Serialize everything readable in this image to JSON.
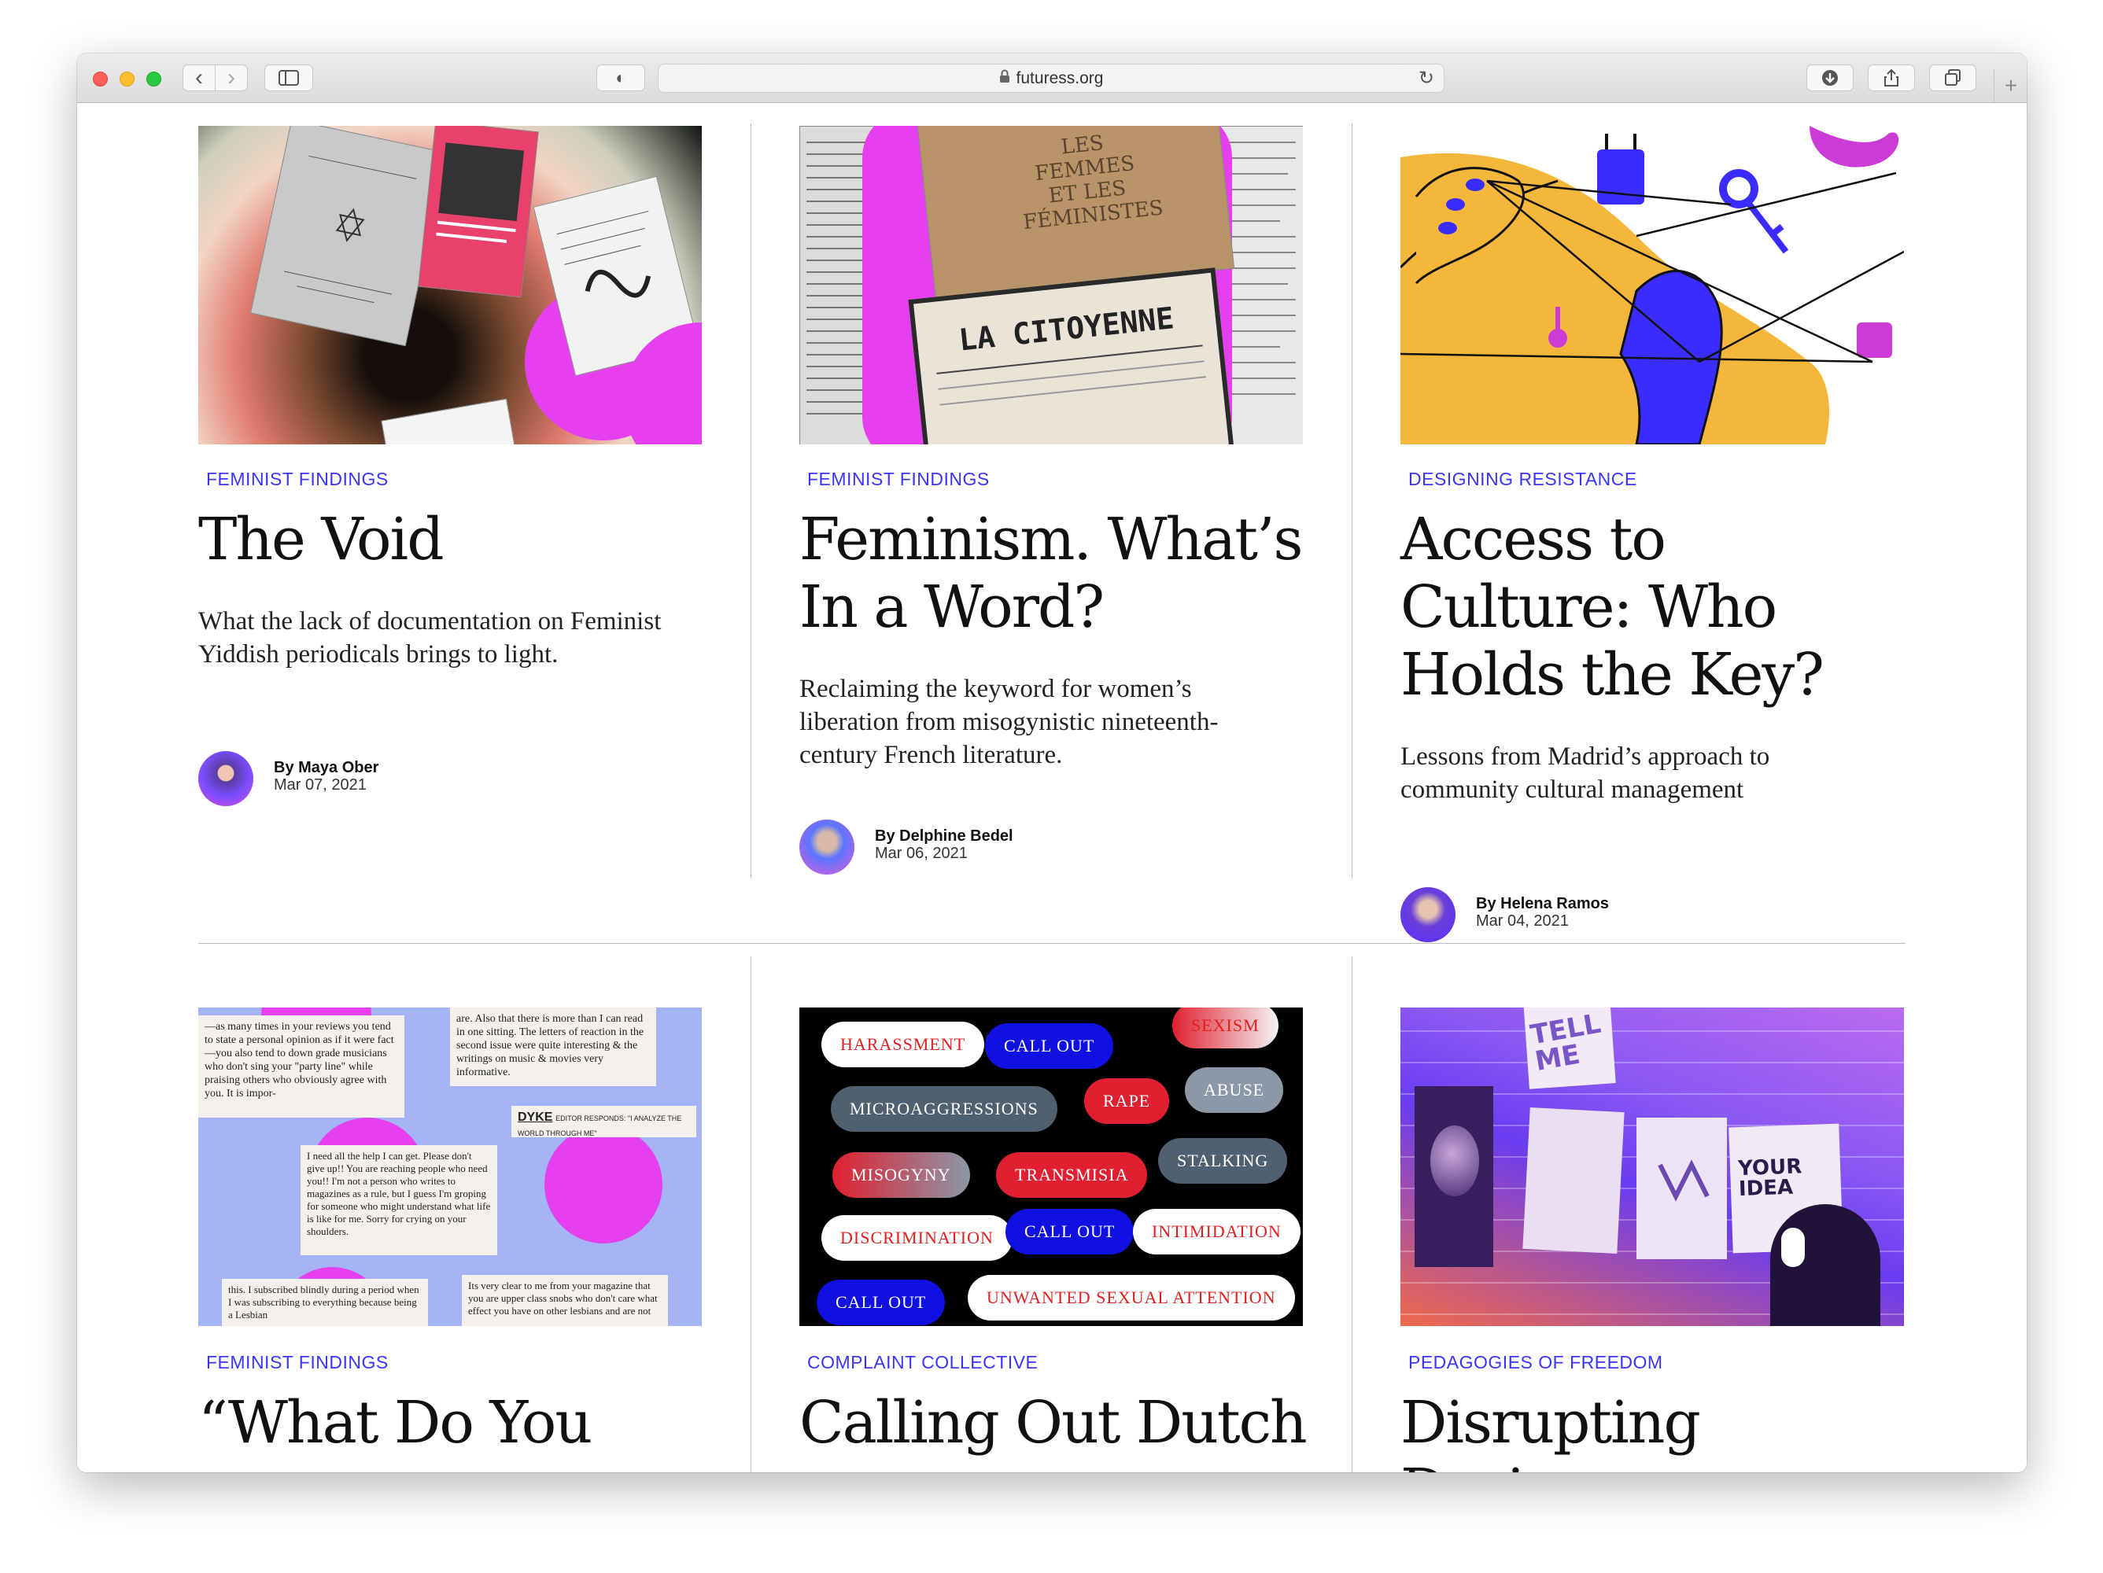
{
  "browser": {
    "url": "futuress.org",
    "icons": [
      "back-icon",
      "forward-icon",
      "sidebar-icon",
      "shield-icon",
      "lock-icon",
      "reload-icon",
      "download-icon",
      "share-icon",
      "tabs-icon",
      "new-tab-icon"
    ],
    "back_glyph": "‹",
    "forward_glyph": "›",
    "reload_glyph": "↻",
    "download_glyph": "⬇",
    "share_glyph": "⇧",
    "tabs_glyph": "⧉",
    "new_tab_glyph": "+",
    "lock_glyph": "🔒",
    "shield_glyph": "◐"
  },
  "articles": [
    {
      "category": "Feminist Findings",
      "title": "The Void",
      "description": "What the lack of documentation on Feminist Yiddish periodicals brings to light.",
      "author": "By Maya Ober",
      "date": "Mar 07, 2021"
    },
    {
      "category": "Feminist Findings",
      "title": "Feminism. What’s In a Word?",
      "description": "Reclaiming the keyword for women’s liberation from misogynistic nineteenth-century French literature.",
      "author": "By Delphine Bedel",
      "date": "Mar 06, 2021"
    },
    {
      "category": "Designing Resistance",
      "title": "Access to Culture: Who Holds the Key?",
      "description": "Lessons from Madrid’s approach to community cultural management",
      "author": "By Helena Ramos",
      "date": "Mar 04, 2021"
    },
    {
      "category": "Feminist Findings",
      "title": "“What Do You"
    },
    {
      "category": "Complaint Collective",
      "title": "Calling Out Dutch"
    },
    {
      "category": "Pedagogies of Freedom",
      "title": "Disrupting Design"
    }
  ],
  "image_text": {
    "citoyenne": "LA CITOYENNE",
    "femmes": "LES FEMMES ET LES FÉMINISTES",
    "dyke": "DYKE",
    "dyke_sub": "EDITOR RESPONDS: \"I ANALYZE THE WORLD THROUGH ME\"",
    "snippet1": "—as many times in your reviews you tend to state a personal opinion as if it were fact—you also tend to down grade musicians who don't sing your \"party line\" while praising others who obviously agree with you. It is impor-",
    "snippet2": "are. Also that there is more than I can read in one sitting. The letters of reaction in the second issue were quite interesting & the writings on music & movies very informative.",
    "snippet3": "I need all the help I can get. Please don't give up!! You are reaching people who need you!! I'm not a person who writes to magazines as a rule, but I guess I'm groping for someone who might understand what life is like for me. Sorry for crying on your shoulders.",
    "snippet4": "this. I subscribed blindly during a period when I was subscribing to everything because being a Lesbian",
    "snippet5": "Its very clear to me from your magazine that you are upper class snobs who don't care what effect you have on other lesbians and are not",
    "bubbles": [
      "HARASSMENT",
      "CALL OUT",
      "SEXISM",
      "MICROAGGRESSIONS",
      "RAPE",
      "ABUSE",
      "MISOGYNY",
      "TRANSMISIA",
      "STALKING",
      "DISCRIMINATION",
      "CALL OUT",
      "INTIMIDATION",
      "CALL OUT",
      "UNWANTED SEXUAL ATTENTION"
    ],
    "poster_tell": "TELL ME",
    "poster_your": "YOUR IDEA"
  },
  "colors": {
    "accent": "#3b34ff",
    "magenta": "#e63ff0",
    "yellow": "#f4b73c",
    "blue": "#3a2cff"
  }
}
